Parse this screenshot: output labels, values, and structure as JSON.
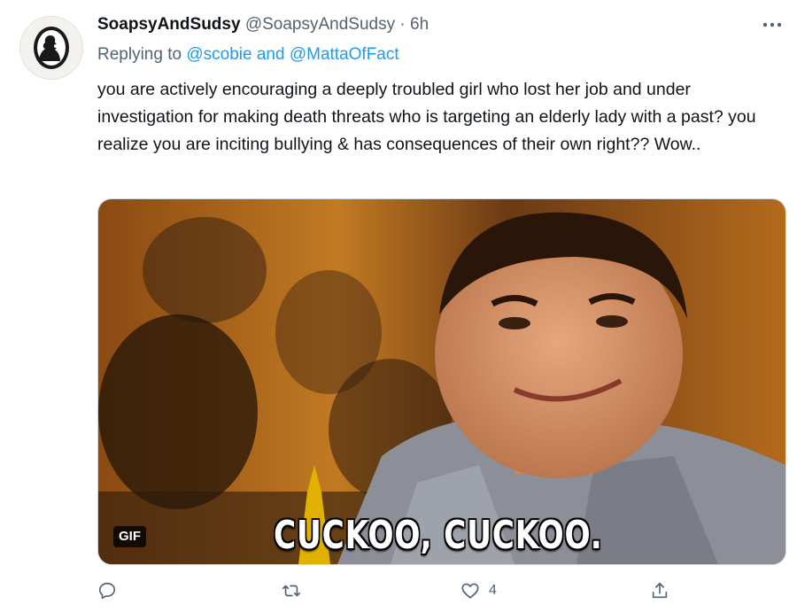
{
  "tweet": {
    "display_name": "SoapsyAndSudsy",
    "handle": "@SoapsyAndSudsy",
    "separator": "·",
    "time": "6h",
    "reply_prefix": "Replying to",
    "reply_mention_1": "@scobie",
    "reply_and": "and",
    "reply_mention_2": "@MattaOfFact",
    "text": "you are actively encouraging a deeply troubled girl who lost her job and under investigation for making death threats who is targeting an elderly lady with a past? you realize you are inciting bullying & has consequences of their own right?? Wow.."
  },
  "media": {
    "badge": "GIF",
    "caption": "CUCKOO, CUCKOO."
  },
  "actions": {
    "reply_count": "",
    "retweet_count": "",
    "like_count": "4",
    "share_count": ""
  },
  "icons": [
    "avatar-silhouette-icon",
    "more-icon",
    "reply-icon",
    "retweet-icon",
    "like-icon",
    "share-icon"
  ],
  "colors": {
    "accent": "#1d9bf0",
    "secondary_text": "#536471",
    "text": "#0f1419"
  }
}
